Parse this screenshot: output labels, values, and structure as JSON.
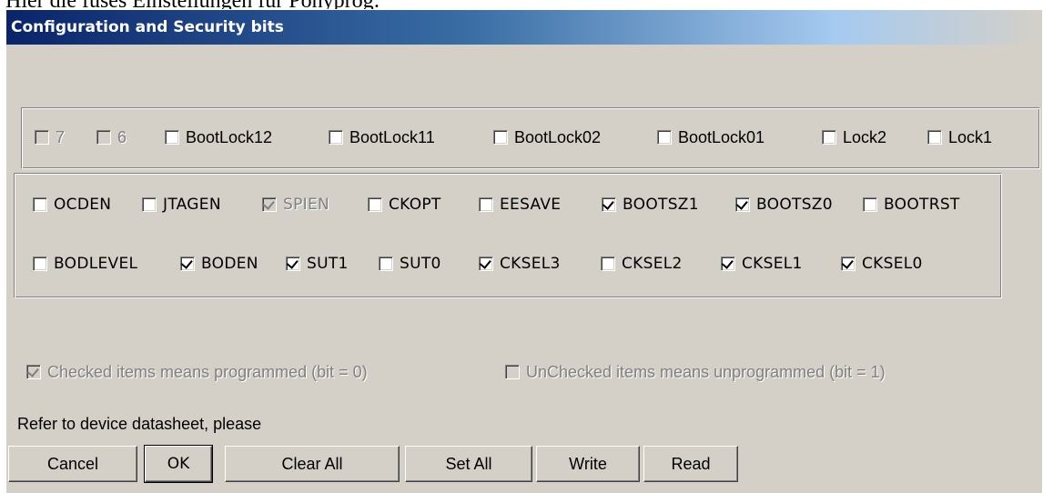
{
  "above_text": "Hier die fuses Einstellungen für Ponyprog:",
  "window": {
    "title": "Configuration and Security bits"
  },
  "lock_bits": [
    {
      "label": "7",
      "checked": false,
      "disabled": true
    },
    {
      "label": "6",
      "checked": false,
      "disabled": true
    },
    {
      "label": "BootLock12",
      "checked": false,
      "disabled": false
    },
    {
      "label": "BootLock11",
      "checked": false,
      "disabled": false
    },
    {
      "label": "BootLock02",
      "checked": false,
      "disabled": false
    },
    {
      "label": "BootLock01",
      "checked": false,
      "disabled": false
    },
    {
      "label": "Lock2",
      "checked": false,
      "disabled": false
    },
    {
      "label": "Lock1",
      "checked": false,
      "disabled": false
    }
  ],
  "fuse_high": [
    {
      "label": "OCDEN",
      "checked": false,
      "disabled": false
    },
    {
      "label": "JTAGEN",
      "checked": false,
      "disabled": false
    },
    {
      "label": "SPIEN",
      "checked": true,
      "disabled": true
    },
    {
      "label": "CKOPT",
      "checked": false,
      "disabled": false
    },
    {
      "label": "EESAVE",
      "checked": false,
      "disabled": false
    },
    {
      "label": "BOOTSZ1",
      "checked": true,
      "disabled": false
    },
    {
      "label": "BOOTSZ0",
      "checked": true,
      "disabled": false
    },
    {
      "label": "BOOTRST",
      "checked": false,
      "disabled": false
    }
  ],
  "fuse_low": [
    {
      "label": "BODLEVEL",
      "checked": false,
      "disabled": false
    },
    {
      "label": "BODEN",
      "checked": true,
      "disabled": false
    },
    {
      "label": "SUT1",
      "checked": true,
      "disabled": false
    },
    {
      "label": "SUT0",
      "checked": false,
      "disabled": false
    },
    {
      "label": "CKSEL3",
      "checked": true,
      "disabled": false
    },
    {
      "label": "CKSEL2",
      "checked": false,
      "disabled": false
    },
    {
      "label": "CKSEL1",
      "checked": true,
      "disabled": false
    },
    {
      "label": "CKSEL0",
      "checked": true,
      "disabled": false
    }
  ],
  "legend": {
    "checked": {
      "label": "Checked items means programmed (bit = 0)",
      "checked": true,
      "disabled": true
    },
    "unchecked": {
      "label": "UnChecked items means unprogrammed (bit = 1)",
      "checked": false,
      "disabled": true
    }
  },
  "hint": "Refer to device datasheet, please",
  "buttons": {
    "cancel": "Cancel",
    "ok": "OK",
    "clear_all": "Clear All",
    "set_all": "Set All",
    "write": "Write",
    "read": "Read"
  }
}
